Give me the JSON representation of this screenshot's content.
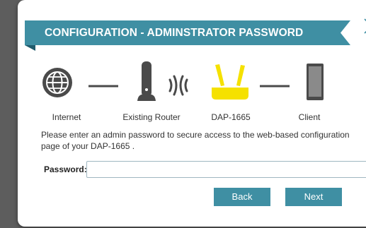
{
  "dialog": {
    "title": "CONFIGURATION - ADMINSTRATOR PASSWORD",
    "close_icon": "close-icon"
  },
  "diagram": {
    "items": [
      {
        "label": "Internet",
        "icon": "globe-icon"
      },
      {
        "label": "Existing Router",
        "icon": "router-icon"
      },
      {
        "label": "DAP-1665",
        "icon": "access-point-icon"
      },
      {
        "label": "Client",
        "icon": "tablet-icon"
      }
    ],
    "wireless_icon": "wireless-signal-icon"
  },
  "form": {
    "description": "Please enter an admin password to secure access to the web-based configuration page of your DAP-1665 .",
    "password_label": "Password:",
    "password_value": ""
  },
  "buttons": {
    "back": "Back",
    "next": "Next"
  },
  "colors": {
    "accent": "#3f8fa3",
    "fold": "#1f5b6c",
    "device_yellow": "#f5e100",
    "icon_dark": "#4a4a4a"
  }
}
